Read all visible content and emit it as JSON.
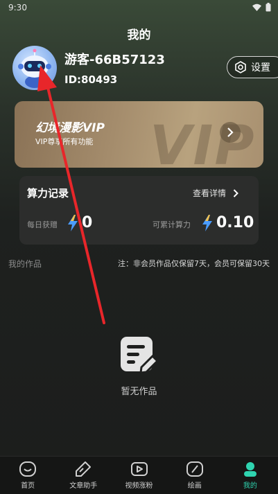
{
  "status_bar": {
    "time": "9:30"
  },
  "header": {
    "title": "我的"
  },
  "profile": {
    "username": "游客-66B57123",
    "user_id": "ID:80493"
  },
  "settings": {
    "label": "设置"
  },
  "vip_card": {
    "title": "幻境漫影VIP",
    "subtitle": "VIP尊享所有功能",
    "watermark": "VIP"
  },
  "power": {
    "title": "算力记录",
    "detail_link": "查看详情",
    "daily_label": "每日获赠",
    "daily_value": "0",
    "accumulated_label": "可累计算力",
    "accumulated_value": "0.10"
  },
  "works": {
    "label": "我的作品",
    "note": "注：非会员作品仅保留7天，会员可保留30天",
    "empty_text": "暂无作品"
  },
  "tabs": [
    {
      "label": "首页",
      "icon": "home-icon"
    },
    {
      "label": "文章助手",
      "icon": "pen-icon"
    },
    {
      "label": "视频涨粉",
      "icon": "video-icon"
    },
    {
      "label": "绘画",
      "icon": "paint-icon"
    },
    {
      "label": "我的",
      "icon": "user-icon",
      "active": true
    }
  ],
  "colors": {
    "accent": "#2fd4b0",
    "bolt": "#4a9cff",
    "annotation": "#e8262a"
  }
}
